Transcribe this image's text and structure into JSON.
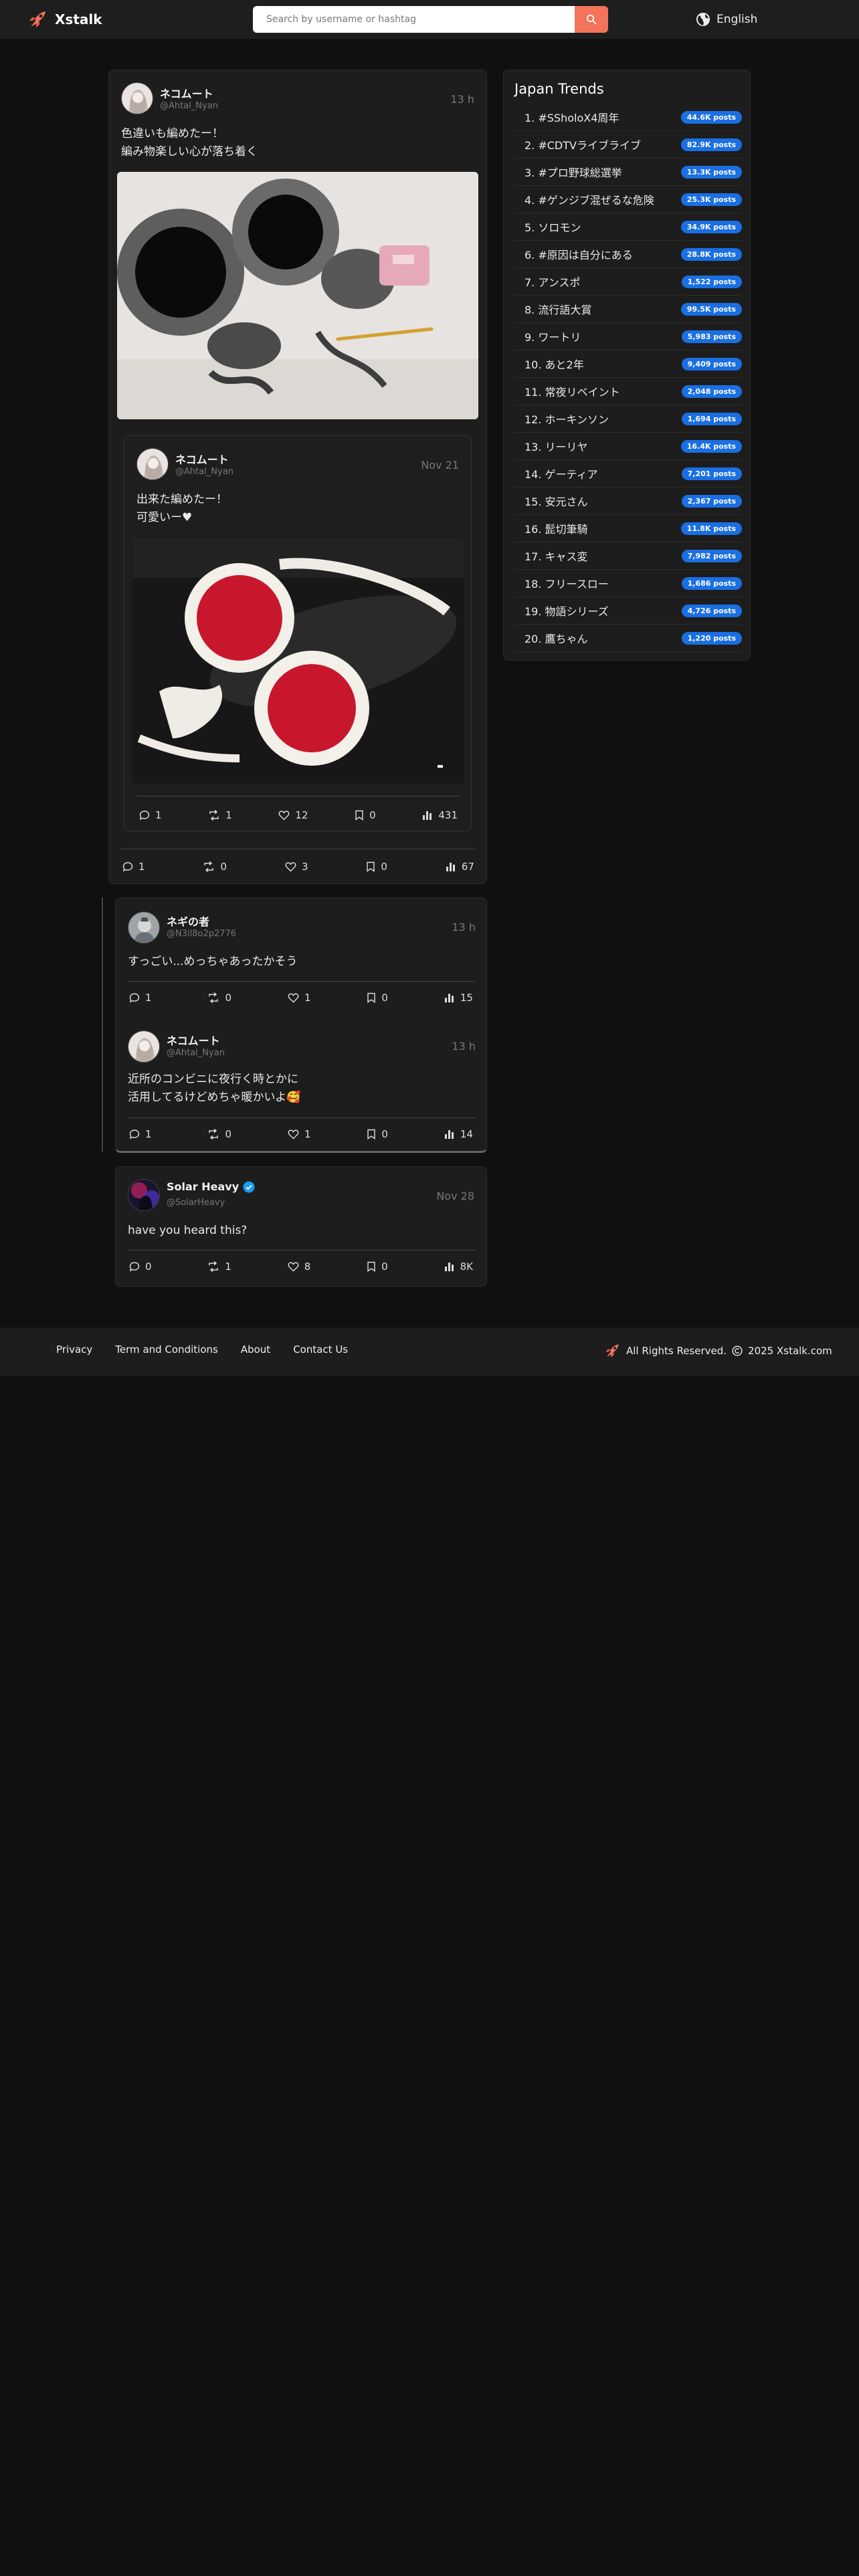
{
  "header": {
    "brand": "Xstalk",
    "search_placeholder": "Search by username or hashtag",
    "language": "English"
  },
  "posts": {
    "p1": {
      "name": "ネコムート",
      "handle": "@Ahtal_Nyan",
      "time": "13 h",
      "text": "色違いも編めたー！\n編み物楽しい心が落ち着く",
      "image_desc": "crochet-fuzzy-ear-warmers",
      "quoted": {
        "name": "ネコムート",
        "handle": "@Ahtal_Nyan",
        "time": "Nov 21",
        "text": "出来た編めたー！\n可愛いー♥",
        "image_desc": "crochet-red-white-ear-warmers",
        "replies": "1",
        "reposts": "1",
        "likes": "12",
        "bookmarks": "0",
        "views": "431"
      },
      "replies": "1",
      "reposts": "0",
      "likes": "3",
      "bookmarks": "0",
      "views": "67"
    },
    "r1": {
      "name": "ネギの者",
      "handle": "@N3il8o2p2776",
      "time": "13 h",
      "text": "すっごい...めっちゃあったかそう",
      "replies": "1",
      "reposts": "0",
      "likes": "1",
      "bookmarks": "0",
      "views": "15"
    },
    "r2": {
      "name": "ネコムート",
      "handle": "@Ahtal_Nyan",
      "time": "13 h",
      "text": "近所のコンビニに夜行く時とかに\n活用してるけどめちゃ暖かいよ🥰",
      "replies": "1",
      "reposts": "0",
      "likes": "1",
      "bookmarks": "0",
      "views": "14"
    },
    "p2": {
      "name": "Solar Heavy",
      "handle": "@SolarHeavy",
      "time": "Nov 28",
      "text": "have you heard this?",
      "replies": "0",
      "reposts": "1",
      "likes": "8",
      "bookmarks": "0",
      "views": "8K"
    }
  },
  "trends": {
    "title": "Japan Trends",
    "items": [
      {
        "label": "1. #SSholoX4周年",
        "count": "44.6K posts"
      },
      {
        "label": "2. #CDTVライブライブ",
        "count": "82.9K posts"
      },
      {
        "label": "3. #プロ野球総選挙",
        "count": "13.3K posts"
      },
      {
        "label": "4. #ゲンジブ混ぜるな危険",
        "count": "25.3K posts"
      },
      {
        "label": "5. ソロモン",
        "count": "34.9K posts"
      },
      {
        "label": "6. #原因は自分にある",
        "count": "28.8K posts"
      },
      {
        "label": "7. アンスポ",
        "count": "1,522 posts"
      },
      {
        "label": "8. 流行語大賞",
        "count": "99.5K posts"
      },
      {
        "label": "9. ワートリ",
        "count": "5,983 posts"
      },
      {
        "label": "10. あと2年",
        "count": "9,409 posts"
      },
      {
        "label": "11. 常夜リベイント",
        "count": "2,048 posts"
      },
      {
        "label": "12. ホーキンソン",
        "count": "1,694 posts"
      },
      {
        "label": "13. リーリヤ",
        "count": "16.4K posts"
      },
      {
        "label": "14. ゲーティア",
        "count": "7,201 posts"
      },
      {
        "label": "15. 安元さん",
        "count": "2,367 posts"
      },
      {
        "label": "16. 髭切筆騎",
        "count": "11.8K posts"
      },
      {
        "label": "17. キャス変",
        "count": "7,982 posts"
      },
      {
        "label": "18. フリースロー",
        "count": "1,686 posts"
      },
      {
        "label": "19. 物語シリーズ",
        "count": "4,726 posts"
      },
      {
        "label": "20. 鷹ちゃん",
        "count": "1,220 posts"
      }
    ]
  },
  "footer": {
    "links": [
      "Privacy",
      "Term and Conditions",
      "About",
      "Contact Us"
    ],
    "rights": "All Rights Reserved.",
    "copyright": "2025 Xstalk.com"
  },
  "colors": {
    "accent": "#f4735b",
    "badge": "#1a6fe3",
    "verified": "#1d9bf0",
    "background": "#101010",
    "card": "#1d1d1d"
  }
}
